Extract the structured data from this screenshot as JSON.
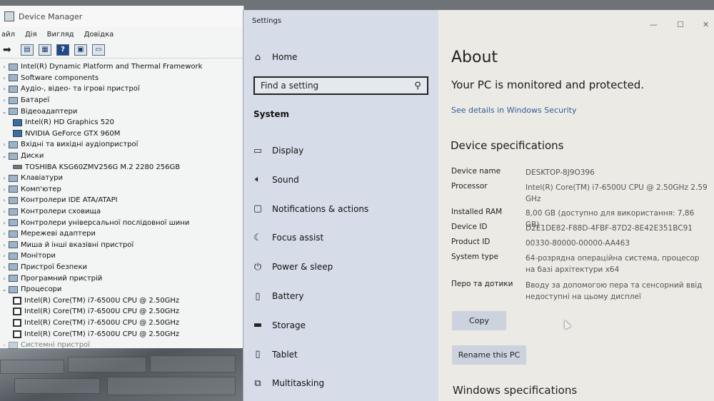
{
  "device_manager": {
    "title": "Device Manager",
    "menu": [
      "айл",
      "Дія",
      "Вигляд",
      "Довідка"
    ],
    "tree": [
      {
        "label": "Intel(R) Dynamic Platform and Thermal Framework",
        "level": 0,
        "expanded": false
      },
      {
        "label": "Software components",
        "level": 0,
        "expanded": false
      },
      {
        "label": "Аудіо-, відео- та ігрові пристрої",
        "level": 0,
        "expanded": false
      },
      {
        "label": "Батареї",
        "level": 0,
        "expanded": false
      },
      {
        "label": "Відеоадаптери",
        "level": 0,
        "expanded": true
      },
      {
        "label": "Intel(R) HD Graphics 520",
        "level": 1,
        "icon": "gpu"
      },
      {
        "label": "NVIDIA GeForce GTX 960M",
        "level": 1,
        "icon": "gpu"
      },
      {
        "label": "Вхідні та вихідні аудіопристрої",
        "level": 0,
        "expanded": false
      },
      {
        "label": "Диски",
        "level": 0,
        "expanded": true
      },
      {
        "label": "TOSHIBA KSG60ZMV256G M.2 2280 256GB",
        "level": 1,
        "icon": "disk"
      },
      {
        "label": "Клавіатури",
        "level": 0,
        "expanded": false
      },
      {
        "label": "Комп'ютер",
        "level": 0,
        "expanded": false
      },
      {
        "label": "Контролери IDE ATA/ATAPI",
        "level": 0,
        "expanded": false
      },
      {
        "label": "Контролери сховища",
        "level": 0,
        "expanded": false
      },
      {
        "label": "Контролери універсальної послідовної шини",
        "level": 0,
        "expanded": false
      },
      {
        "label": "Мережеві адаптери",
        "level": 0,
        "expanded": false
      },
      {
        "label": "Миша й інші вказівні пристрої",
        "level": 0,
        "expanded": false
      },
      {
        "label": "Монітори",
        "level": 0,
        "expanded": false
      },
      {
        "label": "Пристрої безпеки",
        "level": 0,
        "expanded": false
      },
      {
        "label": "Програмний пристрій",
        "level": 0,
        "expanded": false
      },
      {
        "label": "Процесори",
        "level": 0,
        "expanded": true
      },
      {
        "label": "Intel(R) Core(TM) i7-6500U CPU @ 2.50GHz",
        "level": 1,
        "icon": "cpu"
      },
      {
        "label": "Intel(R) Core(TM) i7-6500U CPU @ 2.50GHz",
        "level": 1,
        "icon": "cpu"
      },
      {
        "label": "Intel(R) Core(TM) i7-6500U CPU @ 2.50GHz",
        "level": 1,
        "icon": "cpu"
      },
      {
        "label": "Intel(R) Core(TM) i7-6500U CPU @ 2.50GHz",
        "level": 1,
        "icon": "cpu"
      },
      {
        "label": "Системні пристрої",
        "level": 0,
        "expanded": false,
        "cut": true
      }
    ]
  },
  "settings": {
    "window_title": "Settings",
    "home_label": "Home",
    "search_placeholder": "Find a setting",
    "section_label": "System",
    "nav_items": [
      {
        "label": "Display",
        "icon": "display-icon"
      },
      {
        "label": "Sound",
        "icon": "sound-icon"
      },
      {
        "label": "Notifications & actions",
        "icon": "notifications-icon"
      },
      {
        "label": "Focus assist",
        "icon": "focus-assist-icon"
      },
      {
        "label": "Power & sleep",
        "icon": "power-icon"
      },
      {
        "label": "Battery",
        "icon": "battery-icon"
      },
      {
        "label": "Storage",
        "icon": "storage-icon"
      },
      {
        "label": "Tablet",
        "icon": "tablet-icon"
      },
      {
        "label": "Multitasking",
        "icon": "multitasking-icon"
      }
    ],
    "content": {
      "heading": "About",
      "protection_status": "Your PC is monitored and protected.",
      "security_link": "See details in Windows Security",
      "device_specs_heading": "Device specifications",
      "specs": [
        {
          "key": "Device name",
          "value": "DESKTOP-8J9O396"
        },
        {
          "key": "Processor",
          "value": "Intel(R) Core(TM) i7-6500U CPU @ 2.50GHz   2.59 GHz"
        },
        {
          "key": "Installed RAM",
          "value": "8,00 GB (доступно для використання: 7,86 GB)"
        },
        {
          "key": "Device ID",
          "value": "D2E1DE82-F88D-4FBF-87D2-8E42E351BC91"
        },
        {
          "key": "Product ID",
          "value": "00330-80000-00000-AA463"
        },
        {
          "key": "System type",
          "value": "64-розрядна операційна система, процесор на базі архітектури x64"
        },
        {
          "key": "Перо та дотики",
          "value": "Вводу за допомогою пера та сенсорний ввід недоступні на цьому дисплеї"
        }
      ],
      "copy_button": "Copy",
      "rename_button": "Rename this PC",
      "windows_specs_heading": "Windows specifications"
    }
  }
}
